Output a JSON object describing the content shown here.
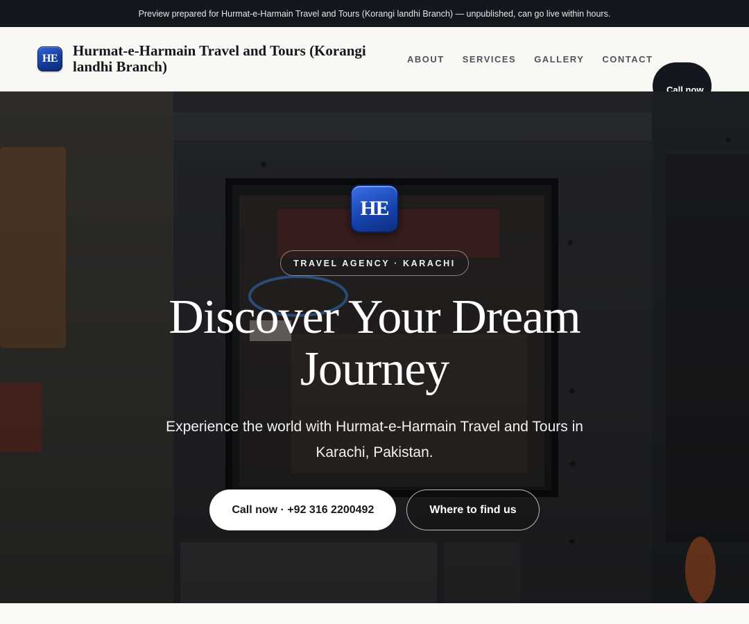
{
  "preview_banner": "Preview prepared for Hurmat-e-Harmain Travel and Tours (Korangi landhi Branch) — unpublished, can go live within hours.",
  "header": {
    "logo_text": "HE",
    "brand_name": "Hurmat-e-Harmain Travel and Tours (Korangi landhi Branch)",
    "nav": [
      "ABOUT",
      "SERVICES",
      "GALLERY",
      "CONTACT"
    ],
    "call_label": "Call now"
  },
  "hero": {
    "logo_text": "HE",
    "eyebrow": "TRAVEL AGENCY · KARACHI",
    "title": "Discover Your Dream Journey",
    "subtitle": "Experience the world with Hurmat-e-Harmain Travel and Tours in Karachi, Pakistan.",
    "primary_cta": "Call now · +92 316 2200492",
    "secondary_cta": "Where to find us"
  },
  "colors": {
    "brand_blue": "#1744b0",
    "dark": "#14171d",
    "page_bg": "#faf9f6"
  }
}
